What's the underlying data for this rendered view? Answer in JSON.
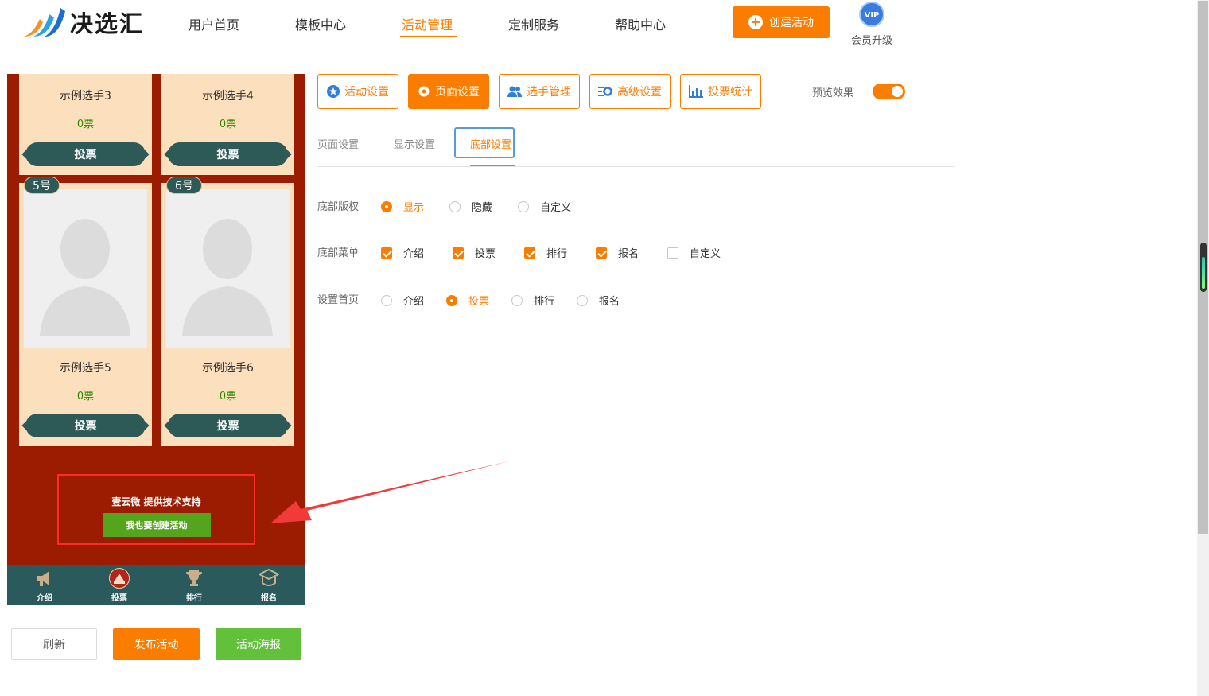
{
  "brand": {
    "name": "决选汇"
  },
  "nav": {
    "items": [
      {
        "label": "用户首页"
      },
      {
        "label": "模板中心"
      },
      {
        "label": "活动管理",
        "active": true
      },
      {
        "label": "定制服务"
      },
      {
        "label": "帮助中心"
      }
    ],
    "create_label": "创建活动",
    "vip_badge": "VIP",
    "vip_label": "会员升级"
  },
  "colors": {
    "accent": "#fa7d00",
    "phone_bg": "#9b1c00",
    "card_bg": "#fce0bd",
    "teal": "#2d5a57",
    "green": "#55a51c"
  },
  "preview": {
    "cards": [
      {
        "name": "示例选手3",
        "votes": "0票",
        "vote_label": "投票"
      },
      {
        "name": "示例选手4",
        "votes": "0票",
        "vote_label": "投票"
      },
      {
        "tag": "5号",
        "name": "示例选手5",
        "votes": "0票",
        "vote_label": "投票"
      },
      {
        "tag": "6号",
        "name": "示例选手6",
        "votes": "0票",
        "vote_label": "投票"
      }
    ],
    "support_text": "壹云微 提供技术支持",
    "support_button": "我也要创建活动",
    "tabbar": [
      {
        "label": "介绍",
        "icon": "megaphone-icon"
      },
      {
        "label": "投票",
        "icon": "vote-icon",
        "active": true
      },
      {
        "label": "排行",
        "icon": "trophy-icon"
      },
      {
        "label": "报名",
        "icon": "signup-icon"
      }
    ]
  },
  "actions": {
    "refresh": "刷新",
    "publish": "发布活动",
    "poster": "活动海报"
  },
  "toolbar": {
    "buttons": [
      {
        "label": "活动设置",
        "icon": "star-icon"
      },
      {
        "label": "页面设置",
        "icon": "gear-icon",
        "active": true
      },
      {
        "label": "选手管理",
        "icon": "users-icon"
      },
      {
        "label": "高级设置",
        "icon": "advanced-settings-icon"
      },
      {
        "label": "投票统计",
        "icon": "bar-chart-icon"
      }
    ],
    "preview_label": "预览效果",
    "preview_on": true
  },
  "subtabs": [
    {
      "label": "页面设置"
    },
    {
      "label": "显示设置"
    },
    {
      "label": "底部设置",
      "active": true
    }
  ],
  "settings": {
    "copyright": {
      "label": "底部版权",
      "options": [
        {
          "label": "显示",
          "selected": true
        },
        {
          "label": "隐藏",
          "selected": false
        },
        {
          "label": "自定义",
          "selected": false
        }
      ]
    },
    "menu": {
      "label": "底部菜单",
      "options": [
        {
          "label": "介绍",
          "checked": true
        },
        {
          "label": "投票",
          "checked": true
        },
        {
          "label": "排行",
          "checked": true
        },
        {
          "label": "报名",
          "checked": true
        },
        {
          "label": "自定义",
          "checked": false
        }
      ]
    },
    "home": {
      "label": "设置首页",
      "options": [
        {
          "label": "介绍",
          "selected": false
        },
        {
          "label": "投票",
          "selected": true
        },
        {
          "label": "排行",
          "selected": false
        },
        {
          "label": "报名",
          "selected": false
        }
      ]
    }
  }
}
